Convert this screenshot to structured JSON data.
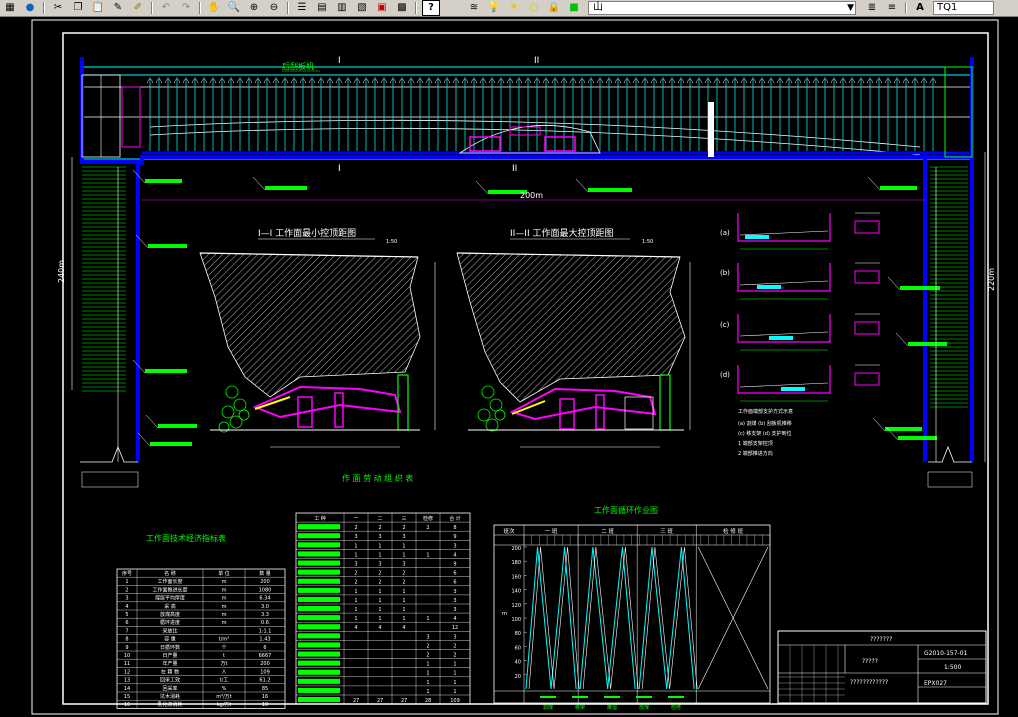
{
  "toolbar": {
    "icons": [
      "cut-icon",
      "copy-icon",
      "paste-icon",
      "match-properties-icon",
      "brush-icon",
      "undo-icon",
      "redo-icon",
      "pan-icon",
      "zoom-realtime-icon",
      "zoom-window-icon",
      "zoom-previous-icon",
      "properties-icon",
      "design-center-icon",
      "tool-palettes-icon",
      "sheet-set-icon",
      "markup-icon",
      "calculator-icon",
      "help-icon",
      "layer-manager-icon",
      "bulb-icon",
      "sun-icon",
      "circle-icon",
      "lock-icon",
      "color-icon"
    ],
    "layer_value": "山",
    "style_value": "TQ1",
    "help_label": "?"
  },
  "colors": {
    "cyan": "#00ffff",
    "green": "#00ff00",
    "blue": "#0000ff",
    "magenta": "#ff00ff",
    "white": "#ffffff",
    "yellow": "#ffff00"
  },
  "drawing": {
    "top_label": "后刮板机",
    "mark_I": "I",
    "mark_II": "II",
    "dim_200": "200m",
    "dim_left": "240m",
    "dim_right": "220m",
    "section1_title": "I—I 工作面最小控顶距图",
    "section2_title": "II—II 工作面最大控顶距图",
    "scale1": "1:50",
    "scale2": "1:50",
    "side_labels": [
      "(a)",
      "(b)",
      "(c)",
      "(d)"
    ],
    "side_num": [
      "1",
      "2"
    ],
    "legend_title": "工作面端部支护方式示意",
    "legend_lines": [
      "(a) 割煤       (b) 刮板机推移",
      "(c) 移支架     (d) 支护到位",
      "1  端部支架控顶",
      "2  端部推进方向"
    ],
    "labor_title": "作 面 劳 动 组 织 表",
    "labor_headers": [
      "工 种",
      "一",
      "二",
      "三",
      "检修",
      "合 计"
    ],
    "labor_rows": [
      [
        "2",
        "2",
        "2",
        "2",
        "8"
      ],
      [
        "3",
        "3",
        "3",
        "",
        "9"
      ],
      [
        "1",
        "1",
        "1",
        "",
        "3"
      ],
      [
        "1",
        "1",
        "1",
        "1",
        "4"
      ],
      [
        "3",
        "3",
        "3",
        "",
        "9"
      ],
      [
        "2",
        "2",
        "2",
        "",
        "6"
      ],
      [
        "2",
        "2",
        "2",
        "",
        "6"
      ],
      [
        "1",
        "1",
        "1",
        "",
        "3"
      ],
      [
        "1",
        "1",
        "1",
        "",
        "3"
      ],
      [
        "1",
        "1",
        "1",
        "",
        "3"
      ],
      [
        "1",
        "1",
        "1",
        "1",
        "4"
      ],
      [
        "4",
        "4",
        "4",
        "",
        "12"
      ],
      [
        "",
        "",
        "",
        "3",
        "3"
      ],
      [
        "",
        "",
        "",
        "2",
        "2"
      ],
      [
        "",
        "",
        "",
        "2",
        "2"
      ],
      [
        "",
        "",
        "",
        "1",
        "1"
      ],
      [
        "",
        "",
        "",
        "1",
        "1"
      ],
      [
        "",
        "",
        "",
        "1",
        "1"
      ],
      [
        "",
        "",
        "",
        "1",
        "1"
      ],
      [
        "27",
        "27",
        "27",
        "28",
        "109"
      ]
    ],
    "tech_title": "工作面技术经济指标表",
    "tech_headers": [
      "序号",
      "名 称",
      "单 位",
      "数 量"
    ],
    "tech_rows": [
      [
        "1",
        "工作面长度",
        "m",
        "200"
      ],
      [
        "2",
        "工作面推进长度",
        "m",
        "1080"
      ],
      [
        "3",
        "煤层平均厚度",
        "m",
        "6.34"
      ],
      [
        "4",
        "采   高",
        "m",
        "3.0"
      ],
      [
        "5",
        "放煤高度",
        "m",
        "3.3"
      ],
      [
        "6",
        "循环进度",
        "m",
        "0.6"
      ],
      [
        "7",
        "采放比",
        "",
        "1:1.1"
      ],
      [
        "8",
        "容   重",
        "t/m³",
        "1.43"
      ],
      [
        "9",
        "日循环数",
        "个",
        "6"
      ],
      [
        "10",
        "日产量",
        "t",
        "6667"
      ],
      [
        "11",
        "年产量",
        "万t",
        "200"
      ],
      [
        "12",
        "在 籍 数",
        "人",
        "109"
      ],
      [
        "13",
        "回采工效",
        "t/工",
        "61.2"
      ],
      [
        "14",
        "回采率",
        "%",
        "85"
      ],
      [
        "15",
        "坑木消耗",
        "m³/万t",
        "16"
      ],
      [
        "16",
        "乳化液消耗",
        "kg/万t",
        "10"
      ]
    ],
    "cycle_title": "工作面循环作业图",
    "cycle_headers": [
      "班次",
      "一 班",
      "二 班",
      "三 班",
      "检 修 班"
    ],
    "cycle_y_ticks": [
      "200",
      "180",
      "160",
      "140",
      "120",
      "100",
      "80",
      "60",
      "40",
      "20"
    ],
    "cycle_y_label": "m",
    "cycle_legend": [
      "割煤",
      "移架",
      "推溜",
      "放煤",
      "检修"
    ],
    "title_block": {
      "title": "???????",
      "drawing_no": "G2010-157-01",
      "scale": "1:500",
      "name": "?????",
      "sub": "????????????",
      "sheet": "EPX027"
    }
  }
}
